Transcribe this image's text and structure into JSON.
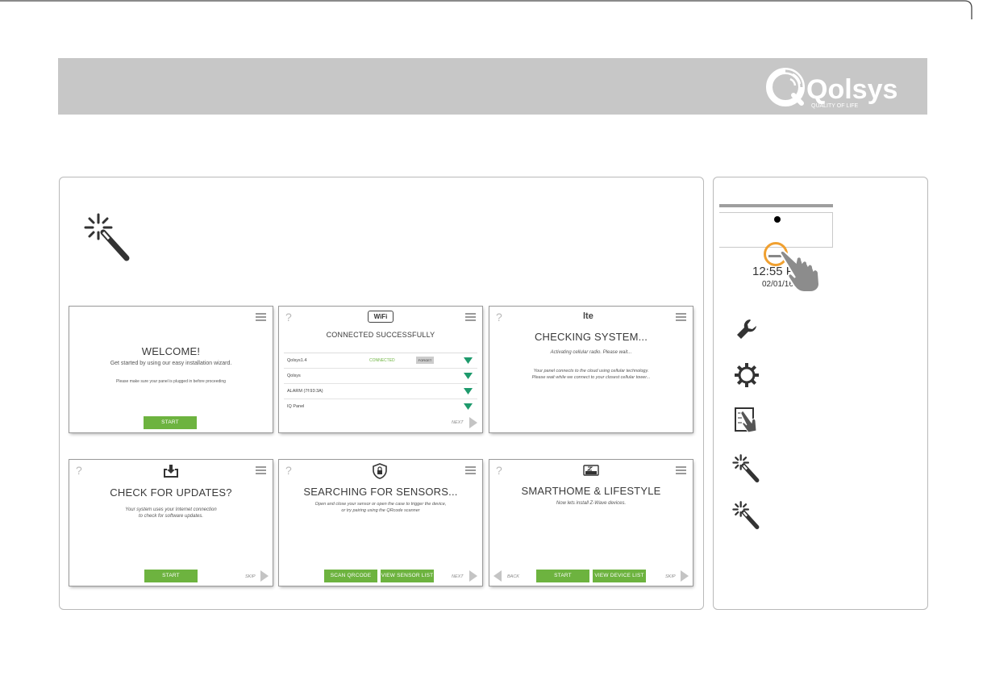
{
  "brand": {
    "logo_text": "Qolsys",
    "tagline": "QUALITY OF LIFE",
    "header_color": "#c7c7c7"
  },
  "accent_color": "#6db33f",
  "screens": {
    "welcome": {
      "title": "WELCOME!",
      "line1": "Get started by using our easy installation wizard.",
      "line2": "Please make sure your panel is plugged in before proceeding",
      "button": "START"
    },
    "wifi": {
      "badge": "WiFi",
      "title": "CONNECTED SUCCESSFULLY",
      "networks": [
        {
          "name": "Qolsys1.4",
          "status": "CONNECTED",
          "action": "FORGET"
        },
        {
          "name": "Qolsys",
          "status": "",
          "action": ""
        },
        {
          "name": "ALARM (7f:93:3A)",
          "status": "",
          "action": ""
        },
        {
          "name": "IQ Panel",
          "status": "",
          "action": ""
        }
      ],
      "next": "NEXT"
    },
    "lte": {
      "badge": "lte",
      "title": "CHECKING SYSTEM...",
      "line1": "Activating cellular radio. Please wait...",
      "line2": "Your panel connects to the cloud using cellular technology.",
      "line3": "Please wait while we connect to your closest cellular tower..."
    },
    "updates": {
      "title": "CHECK FOR UPDATES?",
      "line1": "Your system uses your Internet connection",
      "line2": "to check for software updates.",
      "button": "START",
      "skip": "SKIP"
    },
    "sensors": {
      "title": "SEARCHING FOR SENSORS...",
      "line1": "Open and close your sensor or open the case to trigger the device,",
      "line2": "or try pairing using the QRcode scanner",
      "button1": "SCAN QRCODE",
      "button2": "VIEW SENSOR LIST",
      "next": "NEXT"
    },
    "smarthome": {
      "title": "SMARTHOME & LIFESTYLE",
      "line1": "Now lets install Z-Wave devices.",
      "button1": "START",
      "button2": "VIEW DEVICE LIST",
      "back": "BACK",
      "skip": "SKIP"
    }
  },
  "side": {
    "time": "12:55 P",
    "date": "02/01/16",
    "icons": [
      "wrench-icon",
      "gear-icon",
      "installation-hand-icon",
      "wizard-wand-icon",
      "wizard-wand-icon"
    ]
  }
}
